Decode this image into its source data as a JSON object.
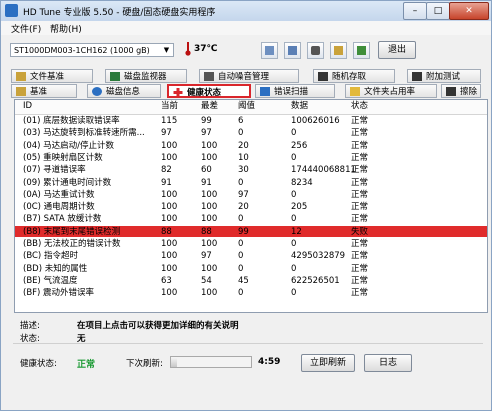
{
  "window": {
    "title": "HD Tune 专业版 5.50 - 硬盘/固态硬盘实用程序",
    "minimize": "–",
    "maximize": "□",
    "close": "✕"
  },
  "menu": {
    "file": "文件(F)",
    "help": "帮助(H)"
  },
  "toolbar": {
    "drive": "ST1000DM003-1CH162 (1000 gB)",
    "temperature": "37℃",
    "exit": "退出"
  },
  "tabs": {
    "row1": [
      "文件基准",
      "磁盘监视器",
      "自动噪音管理",
      "随机存取",
      "附加测试"
    ],
    "row2": [
      "基准",
      "磁盘信息",
      "健康状态",
      "错误扫描",
      "文件夹占用率",
      "擦除"
    ],
    "active": "健康状态"
  },
  "table": {
    "headers": [
      "ID",
      "当前",
      "最差",
      "阈值",
      "数据",
      "状态"
    ],
    "rows": [
      [
        "(01) 底层数据读取错误率",
        "115",
        "99",
        "6",
        "100626016",
        "正常"
      ],
      [
        "(03) 马达旋转到标准转速所需...",
        "97",
        "97",
        "0",
        "0",
        "正常"
      ],
      [
        "(04) 马达启动/停止计数",
        "100",
        "100",
        "20",
        "256",
        "正常"
      ],
      [
        "(05) 重映射扇区计数",
        "100",
        "100",
        "10",
        "0",
        "正常"
      ],
      [
        "(07) 寻道错误率",
        "82",
        "60",
        "30",
        "174440068811",
        "正常"
      ],
      [
        "(09) 累计通电时间计数",
        "91",
        "91",
        "0",
        "8234",
        "正常"
      ],
      [
        "(0A) 马达重试计数",
        "100",
        "100",
        "97",
        "0",
        "正常"
      ],
      [
        "(0C) 通电周期计数",
        "100",
        "100",
        "20",
        "205",
        "正常"
      ],
      [
        "(B7) SATA 放缓计数",
        "100",
        "100",
        "0",
        "0",
        "正常"
      ],
      [
        "(B8) 末尾到末尾错误检测",
        "88",
        "88",
        "99",
        "12",
        "失败"
      ],
      [
        "(BB) 无法校正的错误计数",
        "100",
        "100",
        "0",
        "0",
        "正常"
      ],
      [
        "(BC) 指令超时",
        "100",
        "97",
        "0",
        "4295032879",
        "正常"
      ],
      [
        "(BD) 未知的属性",
        "100",
        "100",
        "0",
        "0",
        "正常"
      ],
      [
        "(BE) 气流温度",
        "63",
        "54",
        "45",
        "622526501",
        "正常"
      ],
      [
        "(BF) 震动外错误率",
        "100",
        "100",
        "0",
        "0",
        "正常"
      ]
    ],
    "failed_row": 9
  },
  "description": {
    "label": "描述:",
    "text": "在项目上点击可以获得更加详细的有关说明",
    "status_label": "状态:",
    "status": "无"
  },
  "footer": {
    "health_label": "健康状态:",
    "health_value": "正常",
    "refresh_label": "下次刷新:",
    "refresh_progress": 0.08,
    "countdown": "4:59",
    "refresh_button": "立即刷新",
    "log_button": "日志"
  },
  "colors": {
    "failed_row": "#e02b2b",
    "active_tab_border": "#d9262c",
    "health_ok": "#1a9a33"
  }
}
